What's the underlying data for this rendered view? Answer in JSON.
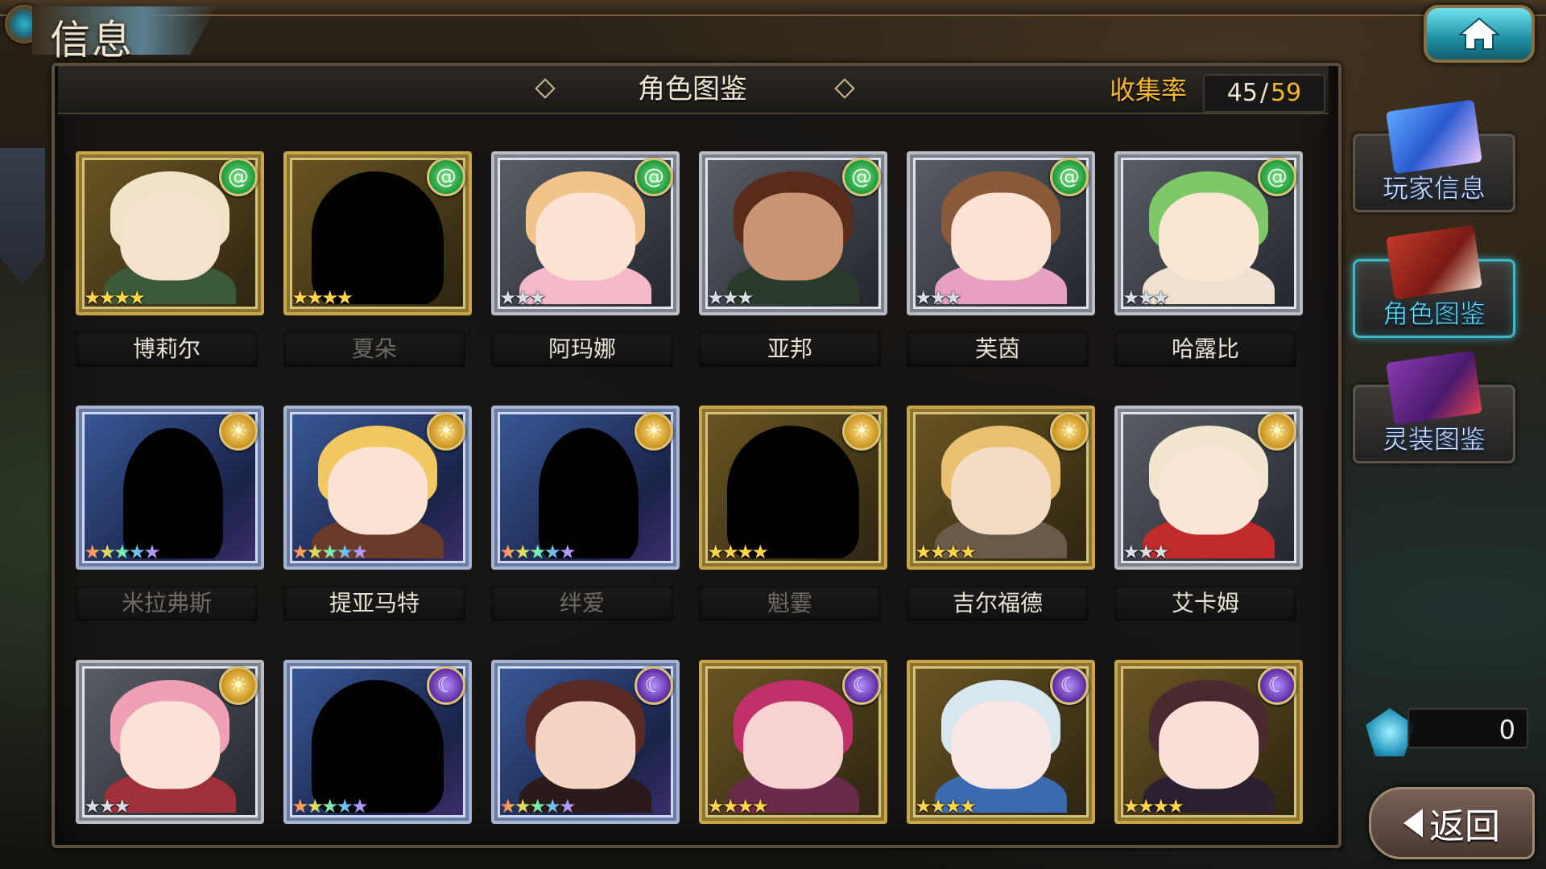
{
  "header": {
    "screen_title": "信息",
    "panel_title": "角色图鉴",
    "collection_label": "收集率",
    "collection_current": "45",
    "collection_separator": "/",
    "collection_total": "59"
  },
  "colors": {
    "accent_gold": "#f2b632",
    "accent_cyan": "#3fb8c8",
    "locked_text": "#6e6a63"
  },
  "cards": [
    {
      "name": "博莉尔",
      "element": "wind",
      "stars": 4,
      "frame": "gold",
      "locked": false
    },
    {
      "name": "夏朵",
      "element": "wind",
      "stars": 4,
      "frame": "gold",
      "locked": true
    },
    {
      "name": "阿玛娜",
      "element": "wind",
      "stars": 3,
      "frame": "silver",
      "locked": false
    },
    {
      "name": "亚邦",
      "element": "wind",
      "stars": 3,
      "frame": "silver",
      "locked": false
    },
    {
      "name": "芙茵",
      "element": "wind",
      "stars": 3,
      "frame": "silver",
      "locked": false
    },
    {
      "name": "哈露比",
      "element": "wind",
      "stars": 3,
      "frame": "silver",
      "locked": false
    },
    {
      "name": "米拉弗斯",
      "element": "sun",
      "stars": 5,
      "frame": "blue",
      "locked": true
    },
    {
      "name": "提亚马特",
      "element": "sun",
      "stars": 5,
      "frame": "blue",
      "locked": false
    },
    {
      "name": "绊爱",
      "element": "sun",
      "stars": 5,
      "frame": "blue",
      "locked": true
    },
    {
      "name": "魁霎",
      "element": "sun",
      "stars": 4,
      "frame": "gold",
      "locked": true
    },
    {
      "name": "吉尔福德",
      "element": "sun",
      "stars": 4,
      "frame": "gold",
      "locked": false
    },
    {
      "name": "艾卡姆",
      "element": "sun",
      "stars": 3,
      "frame": "silver",
      "locked": false
    },
    {
      "name": "",
      "element": "sun",
      "stars": 3,
      "frame": "silver",
      "locked": false
    },
    {
      "name": "",
      "element": "moon",
      "stars": 5,
      "frame": "blue",
      "locked": true
    },
    {
      "name": "",
      "element": "moon",
      "stars": 5,
      "frame": "blue",
      "locked": false
    },
    {
      "name": "",
      "element": "moon",
      "stars": 4,
      "frame": "gold",
      "locked": false
    },
    {
      "name": "",
      "element": "moon",
      "stars": 4,
      "frame": "gold",
      "locked": false
    },
    {
      "name": "",
      "element": "moon",
      "stars": 4,
      "frame": "gold",
      "locked": false
    }
  ],
  "sidebar": {
    "player_info": "玩家信息",
    "character_codex": "角色图鉴",
    "equipment_codex": "灵装图鉴"
  },
  "currency": {
    "icon": "blue-gem-icon",
    "amount": "0"
  },
  "back_button": {
    "label": "返回"
  }
}
